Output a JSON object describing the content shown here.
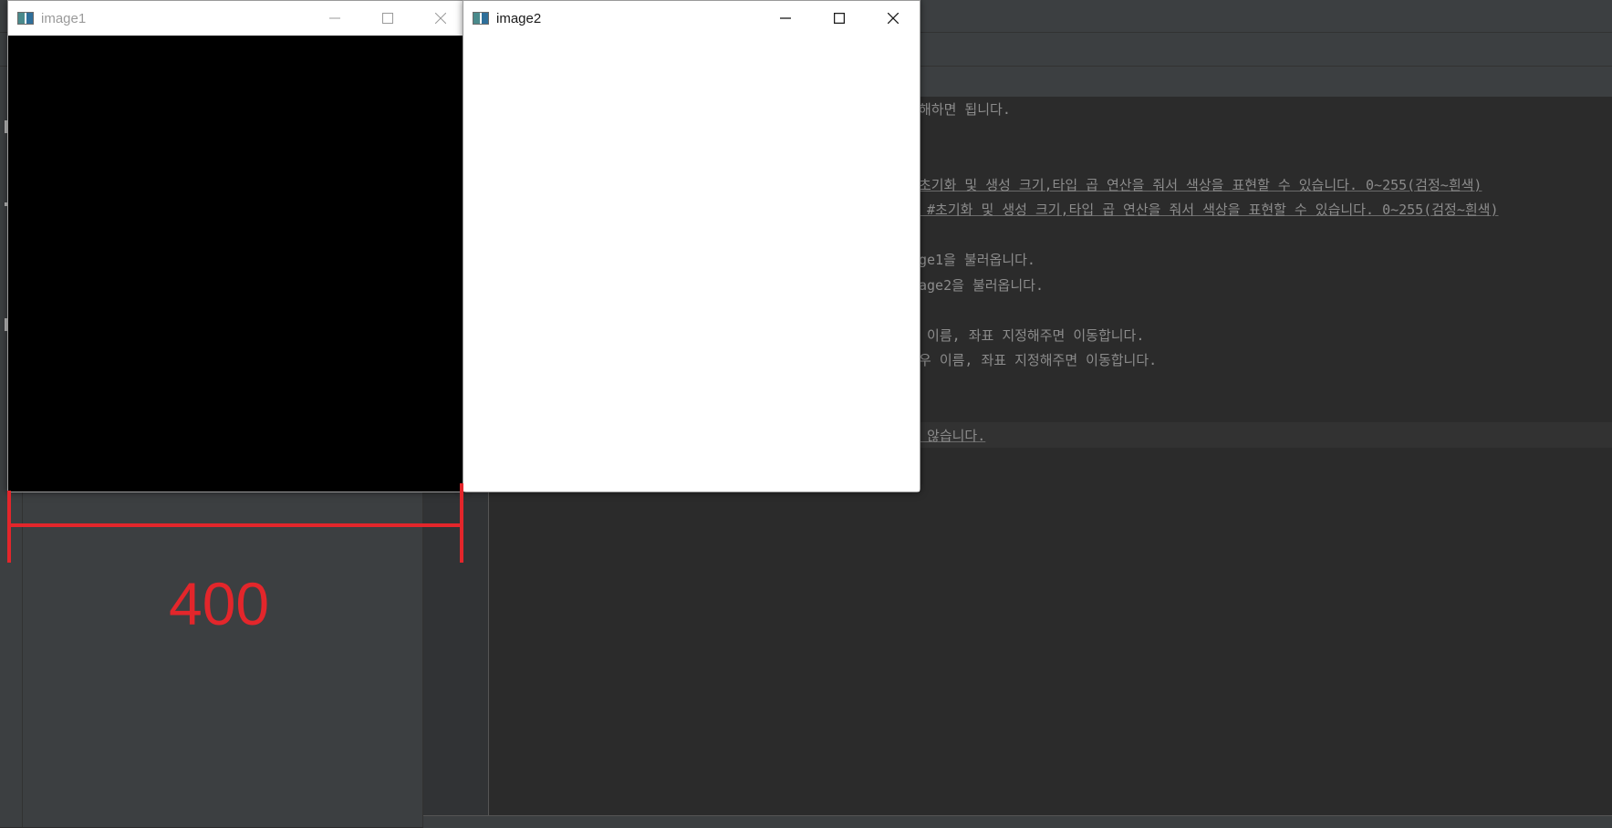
{
  "windows": {
    "image1": {
      "title": "image1",
      "content_color": "#000000"
    },
    "image2": {
      "title": "image2",
      "content_color": "#ffffff"
    }
  },
  "annotation": {
    "width_label": "400",
    "color": "#e3262b"
  },
  "editor": {
    "lines": [
      "해하면 됩니다.",
      "초기화 및 생성 크기,타입 곱 연산을 줘서 색상을 표현할 수 있습니다. 0~255(검정~흰색)",
      " #초기화 및 생성 크기,타입 곱 연산을 줘서 색상을 표현할 수 있습니다. 0~255(검정~흰색)",
      "ge1을 불러옵니다.",
      "age2을 불러옵니다.",
      " 이름, 좌표 지정해주면 이동합니다.",
      "우 이름, 좌표 지정해주면 이동합니다.",
      " 않습니다."
    ]
  },
  "icons": {
    "window_app": "opencv-window-icon",
    "minimize": "minimize-icon",
    "maximize": "maximize-icon",
    "close": "close-icon"
  }
}
